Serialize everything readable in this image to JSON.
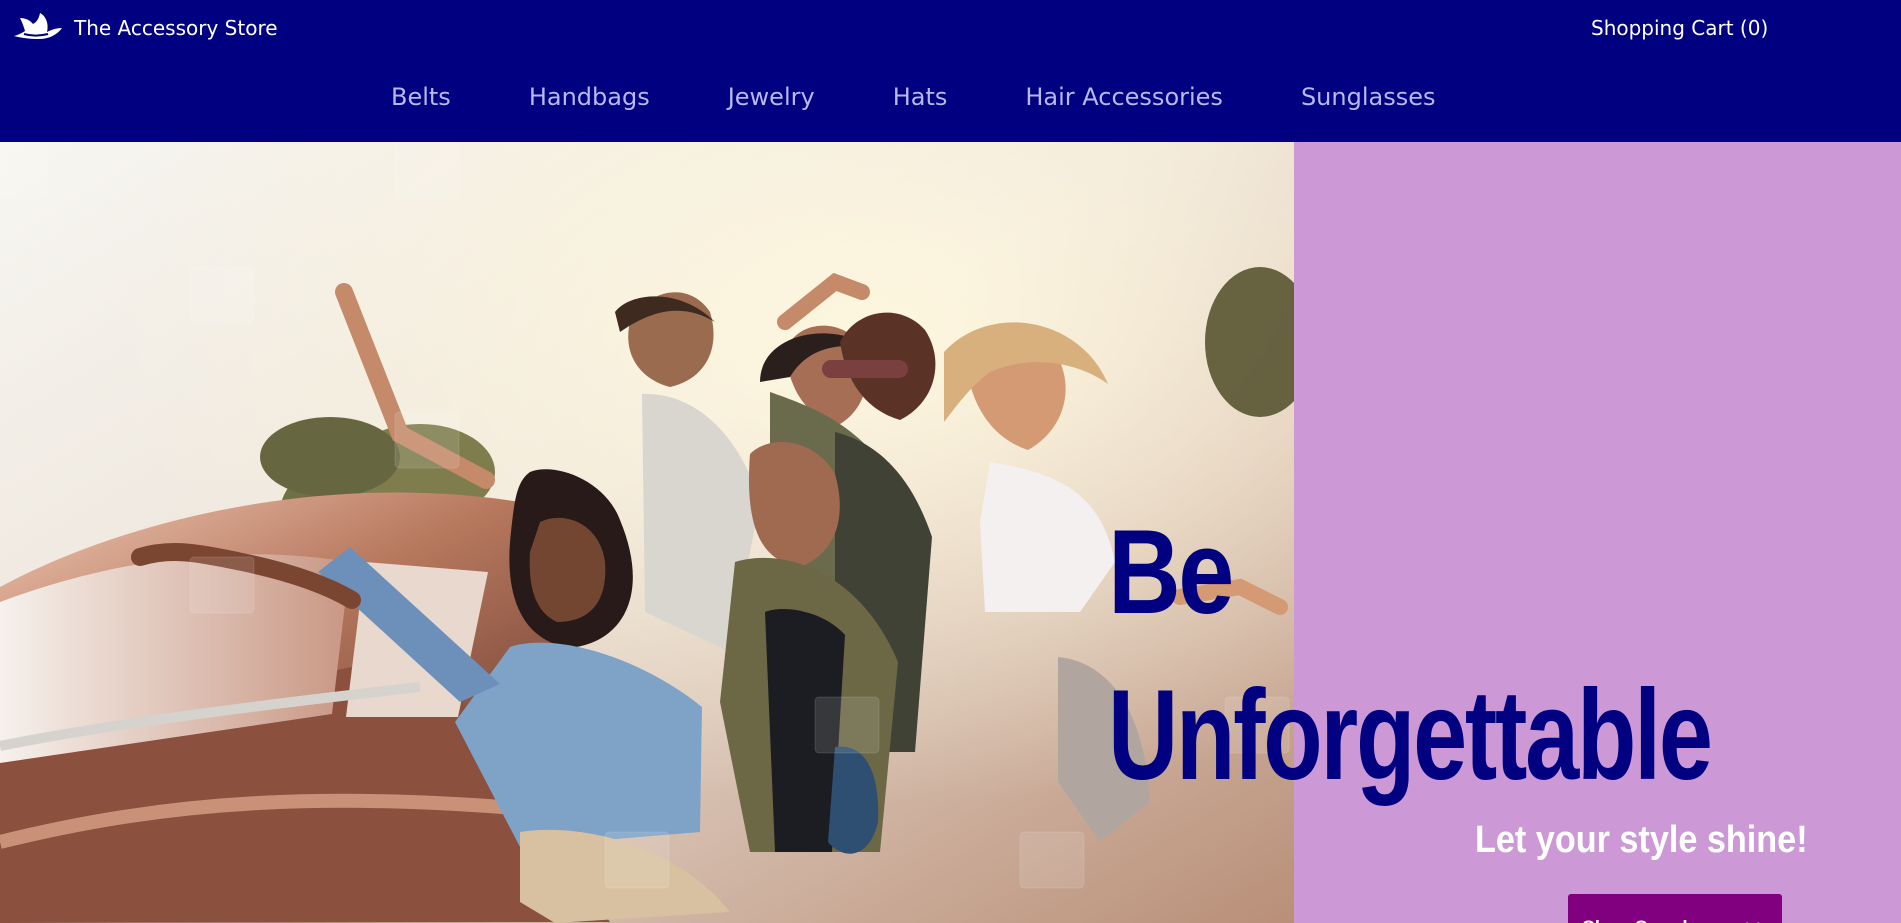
{
  "header": {
    "store_name": "The Accessory Store",
    "cart_label": "Shopping Cart (0)"
  },
  "nav": {
    "items": [
      {
        "label": "Belts"
      },
      {
        "label": "Handbags"
      },
      {
        "label": "Jewelry"
      },
      {
        "label": "Hats"
      },
      {
        "label": "Hair Accessories"
      },
      {
        "label": "Sunglasses"
      }
    ]
  },
  "hero": {
    "title_line_1": "Be",
    "title_line_2": "Unforgettable",
    "subtitle": "Let your style shine!",
    "button_label": "Shop Sunglasses >>"
  },
  "colors": {
    "header_bg": "#000080",
    "panel_bg": "#cc99d6",
    "button_bg": "#800080",
    "title_text": "#000080",
    "nav_text": "#b8b8ee",
    "white_text": "#ffffff"
  },
  "icons": {
    "logo": "hat-icon"
  }
}
